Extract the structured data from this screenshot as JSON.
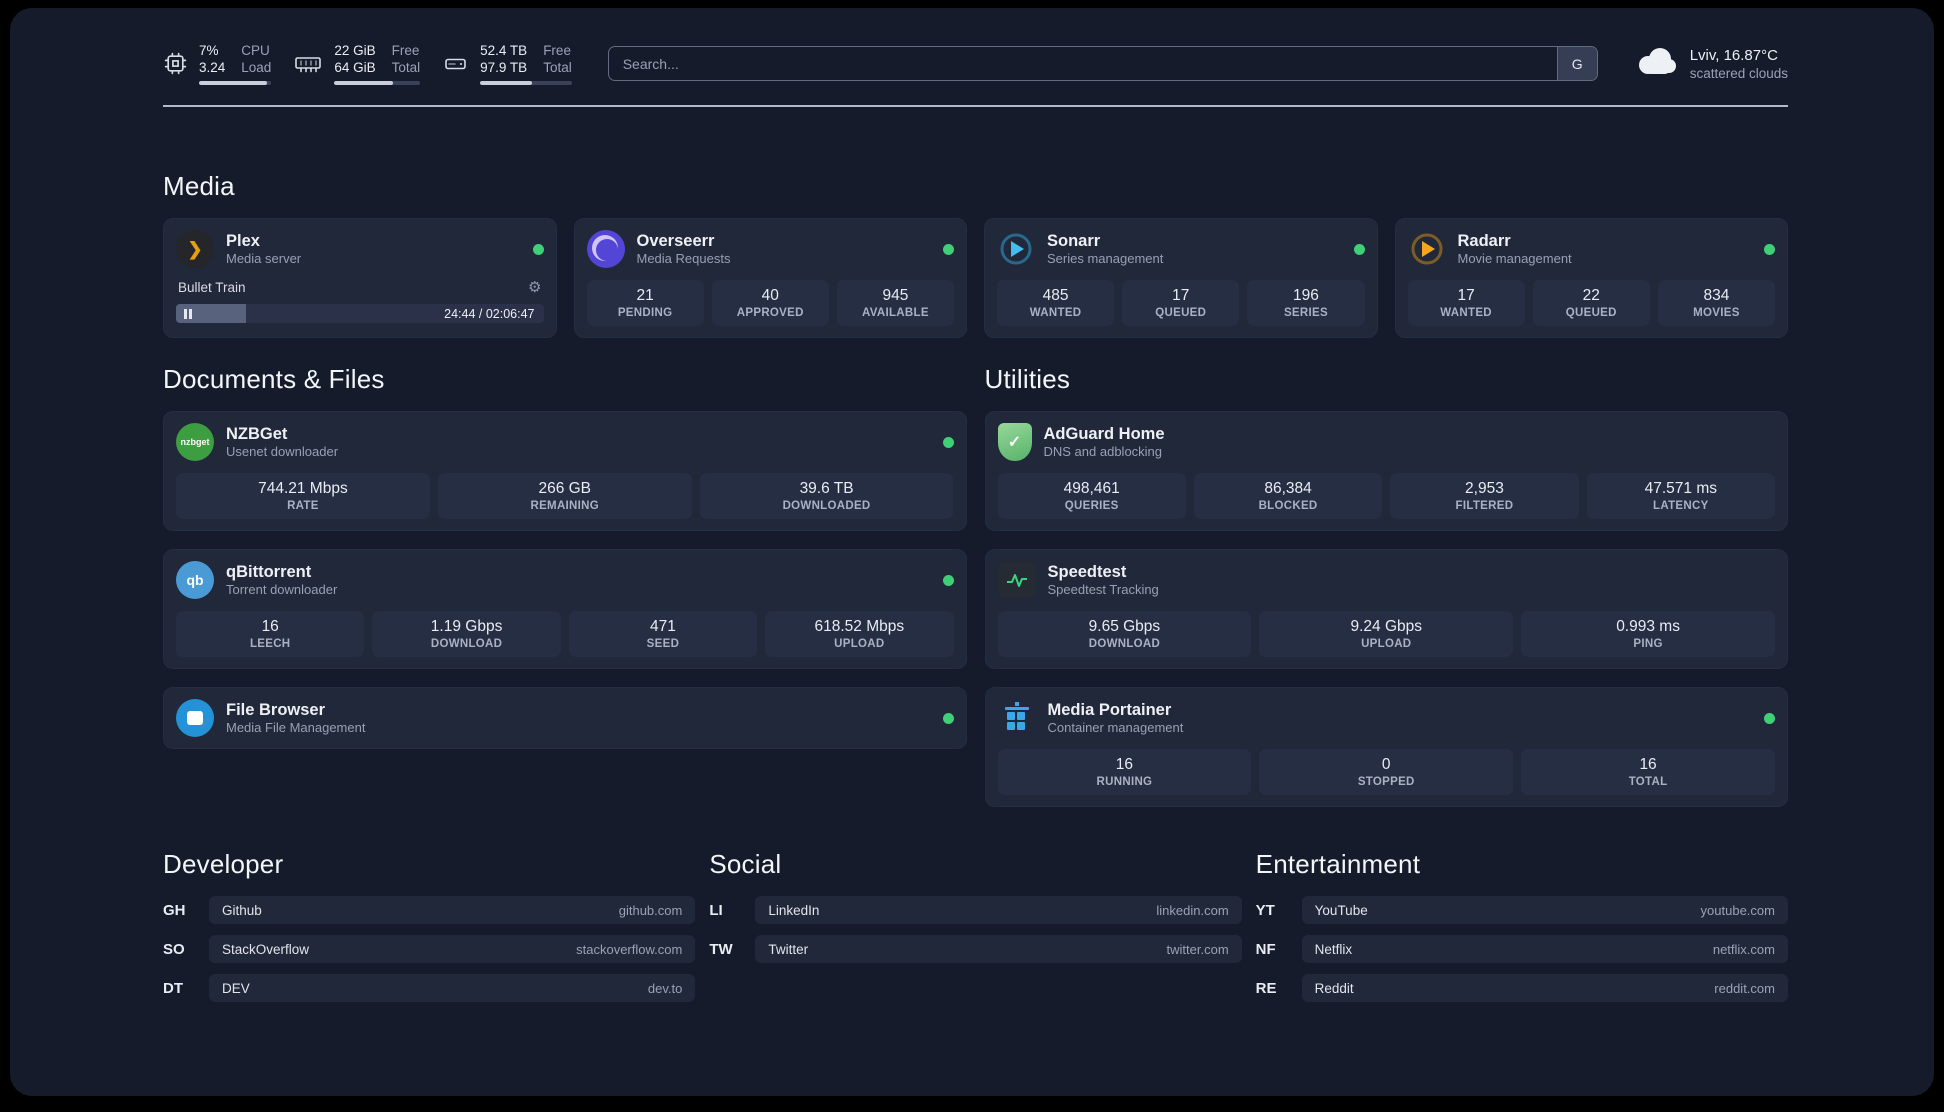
{
  "topbar": {
    "cpu": {
      "line1": "7%",
      "line2": "3.24",
      "lab1": "CPU",
      "lab2": "Load"
    },
    "ram": {
      "line1": "22 GiB",
      "line2": "64 GiB",
      "lab1": "Free",
      "lab2": "Total"
    },
    "disk": {
      "line1": "52.4 TB",
      "line2": "97.9 TB",
      "lab1": "Free",
      "lab2": "Total"
    },
    "search_placeholder": "Search...",
    "search_button": "G",
    "weather_location": "Lviv, 16.87°C",
    "weather_condition": "scattered clouds"
  },
  "media": {
    "heading": "Media",
    "plex": {
      "title": "Plex",
      "subtitle": "Media server",
      "now_playing": "Bullet Train",
      "time": "24:44 / 02:06:47"
    },
    "overseerr": {
      "title": "Overseerr",
      "subtitle": "Media Requests",
      "stats": [
        {
          "value": "21",
          "label": "PENDING"
        },
        {
          "value": "40",
          "label": "APPROVED"
        },
        {
          "value": "945",
          "label": "AVAILABLE"
        }
      ]
    },
    "sonarr": {
      "title": "Sonarr",
      "subtitle": "Series management",
      "stats": [
        {
          "value": "485",
          "label": "WANTED"
        },
        {
          "value": "17",
          "label": "QUEUED"
        },
        {
          "value": "196",
          "label": "SERIES"
        }
      ]
    },
    "radarr": {
      "title": "Radarr",
      "subtitle": "Movie management",
      "stats": [
        {
          "value": "17",
          "label": "WANTED"
        },
        {
          "value": "22",
          "label": "QUEUED"
        },
        {
          "value": "834",
          "label": "MOVIES"
        }
      ]
    }
  },
  "documents": {
    "heading": "Documents & Files",
    "nzbget": {
      "title": "NZBGet",
      "subtitle": "Usenet downloader",
      "stats": [
        {
          "value": "744.21 Mbps",
          "label": "RATE"
        },
        {
          "value": "266 GB",
          "label": "REMAINING"
        },
        {
          "value": "39.6 TB",
          "label": "DOWNLOADED"
        }
      ]
    },
    "qbittorrent": {
      "title": "qBittorrent",
      "subtitle": "Torrent downloader",
      "stats": [
        {
          "value": "16",
          "label": "LEECH"
        },
        {
          "value": "1.19 Gbps",
          "label": "DOWNLOAD"
        },
        {
          "value": "471",
          "label": "SEED"
        },
        {
          "value": "618.52 Mbps",
          "label": "UPLOAD"
        }
      ]
    },
    "filebrowser": {
      "title": "File Browser",
      "subtitle": "Media File Management"
    }
  },
  "utilities": {
    "heading": "Utilities",
    "adguard": {
      "title": "AdGuard Home",
      "subtitle": "DNS and adblocking",
      "stats": [
        {
          "value": "498,461",
          "label": "QUERIES"
        },
        {
          "value": "86,384",
          "label": "BLOCKED"
        },
        {
          "value": "2,953",
          "label": "FILTERED"
        },
        {
          "value": "47.571 ms",
          "label": "LATENCY"
        }
      ]
    },
    "speedtest": {
      "title": "Speedtest",
      "subtitle": "Speedtest Tracking",
      "stats": [
        {
          "value": "9.65 Gbps",
          "label": "DOWNLOAD"
        },
        {
          "value": "9.24 Gbps",
          "label": "UPLOAD"
        },
        {
          "value": "0.993 ms",
          "label": "PING"
        }
      ]
    },
    "portainer": {
      "title": "Media Portainer",
      "subtitle": "Container management",
      "stats": [
        {
          "value": "16",
          "label": "RUNNING"
        },
        {
          "value": "0",
          "label": "STOPPED"
        },
        {
          "value": "16",
          "label": "TOTAL"
        }
      ]
    }
  },
  "bookmarks": {
    "developer": {
      "heading": "Developer",
      "items": [
        {
          "abbr": "GH",
          "name": "Github",
          "url": "github.com"
        },
        {
          "abbr": "SO",
          "name": "StackOverflow",
          "url": "stackoverflow.com"
        },
        {
          "abbr": "DT",
          "name": "DEV",
          "url": "dev.to"
        }
      ]
    },
    "social": {
      "heading": "Social",
      "items": [
        {
          "abbr": "LI",
          "name": "LinkedIn",
          "url": "linkedin.com"
        },
        {
          "abbr": "TW",
          "name": "Twitter",
          "url": "twitter.com"
        }
      ]
    },
    "entertainment": {
      "heading": "Entertainment",
      "items": [
        {
          "abbr": "YT",
          "name": "YouTube",
          "url": "youtube.com"
        },
        {
          "abbr": "NF",
          "name": "Netflix",
          "url": "netflix.com"
        },
        {
          "abbr": "RE",
          "name": "Reddit",
          "url": "reddit.com"
        }
      ]
    }
  },
  "icons": {
    "plex_glyph": "❯",
    "gear": "⚙",
    "adguard_check": "✓",
    "nzbget_label": "nzbget",
    "qbittorrent_label": "qb"
  },
  "colors": {
    "status_ok": "#3ecf77",
    "plex_accent": "#e5a00d",
    "background": "#151b2b",
    "card": "#202839"
  }
}
